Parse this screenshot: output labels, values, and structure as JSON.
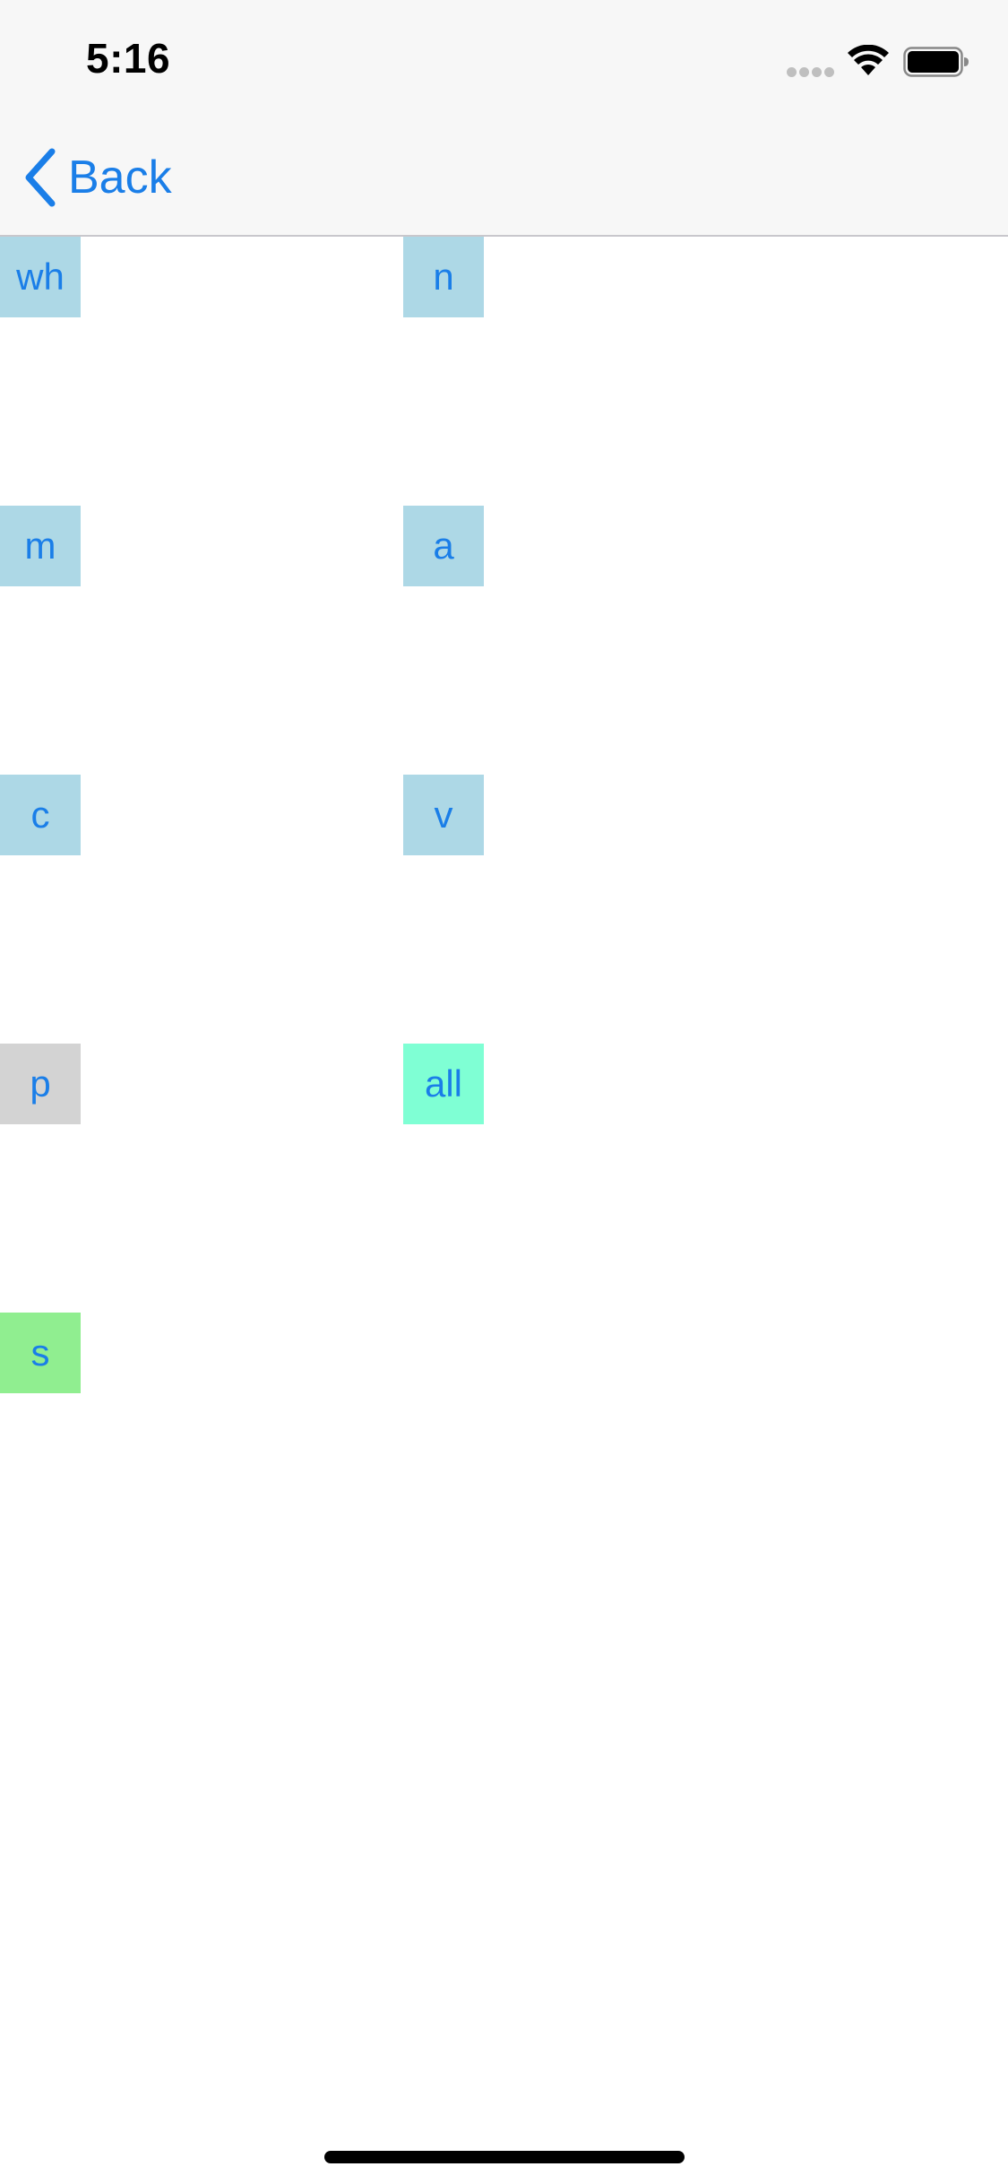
{
  "status_bar": {
    "time": "5:16",
    "signal_icon": "signal-dots-icon",
    "wifi_icon": "wifi-icon",
    "battery_icon": "battery-icon"
  },
  "nav": {
    "back_label": "Back",
    "back_icon": "chevron-left-icon"
  },
  "tiles": [
    {
      "label": "wh",
      "color": "#add8e6"
    },
    {
      "label": "n",
      "color": "#add8e6"
    },
    {
      "label": "m",
      "color": "#add8e6"
    },
    {
      "label": "a",
      "color": "#add8e6"
    },
    {
      "label": "c",
      "color": "#add8e6"
    },
    {
      "label": "v",
      "color": "#add8e6"
    },
    {
      "label": "p",
      "color": "#d3d3d3"
    },
    {
      "label": "all",
      "color": "#7fffd4"
    },
    {
      "label": "s",
      "color": "#90ee90"
    }
  ],
  "colors": {
    "accent": "#1a7ee8",
    "bar_background": "#f7f7f7"
  }
}
